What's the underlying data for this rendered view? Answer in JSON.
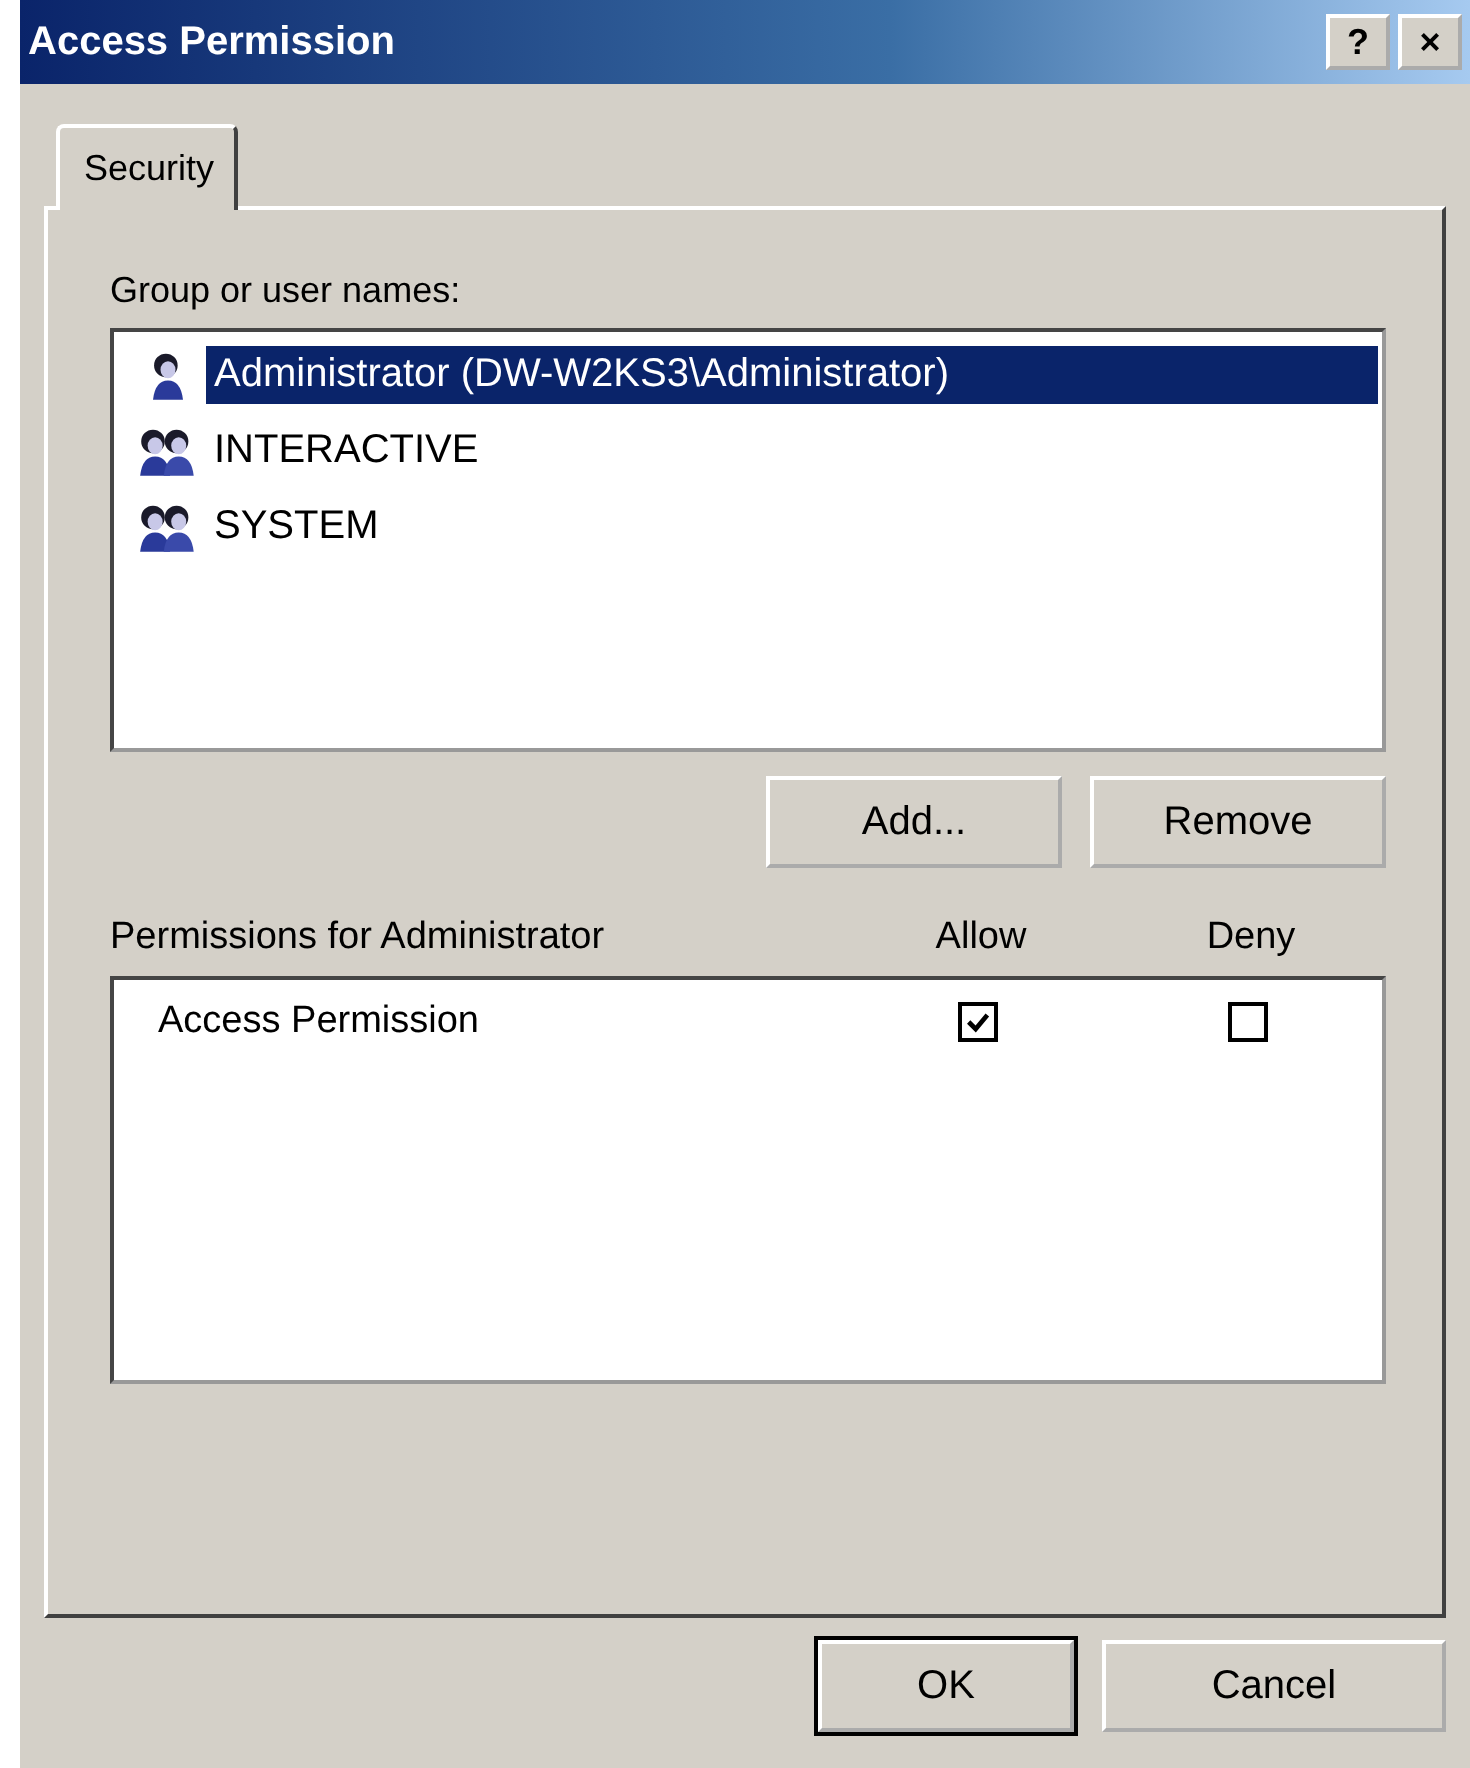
{
  "window": {
    "title": "Access Permission",
    "title_buttons": [
      "?",
      "×"
    ]
  },
  "tabs": [
    {
      "label": "Security",
      "selected": true
    }
  ],
  "group_label": "Group or user names:",
  "users": [
    {
      "name": "Administrator (DW-W2KS3\\Administrator)",
      "kind": "user",
      "selected": true
    },
    {
      "name": "INTERACTIVE",
      "kind": "group",
      "selected": false
    },
    {
      "name": "SYSTEM",
      "kind": "group",
      "selected": false
    }
  ],
  "list_buttons": [
    "Add...",
    "Remove"
  ],
  "permissions": {
    "label": "Permissions for Administrator",
    "columns": [
      "Allow",
      "Deny"
    ],
    "rows": [
      {
        "name": "Access Permission",
        "allow": true,
        "deny": false
      }
    ]
  },
  "buttons": [
    {
      "label": "OK",
      "default": true
    },
    {
      "label": "Cancel",
      "default": false
    }
  ]
}
